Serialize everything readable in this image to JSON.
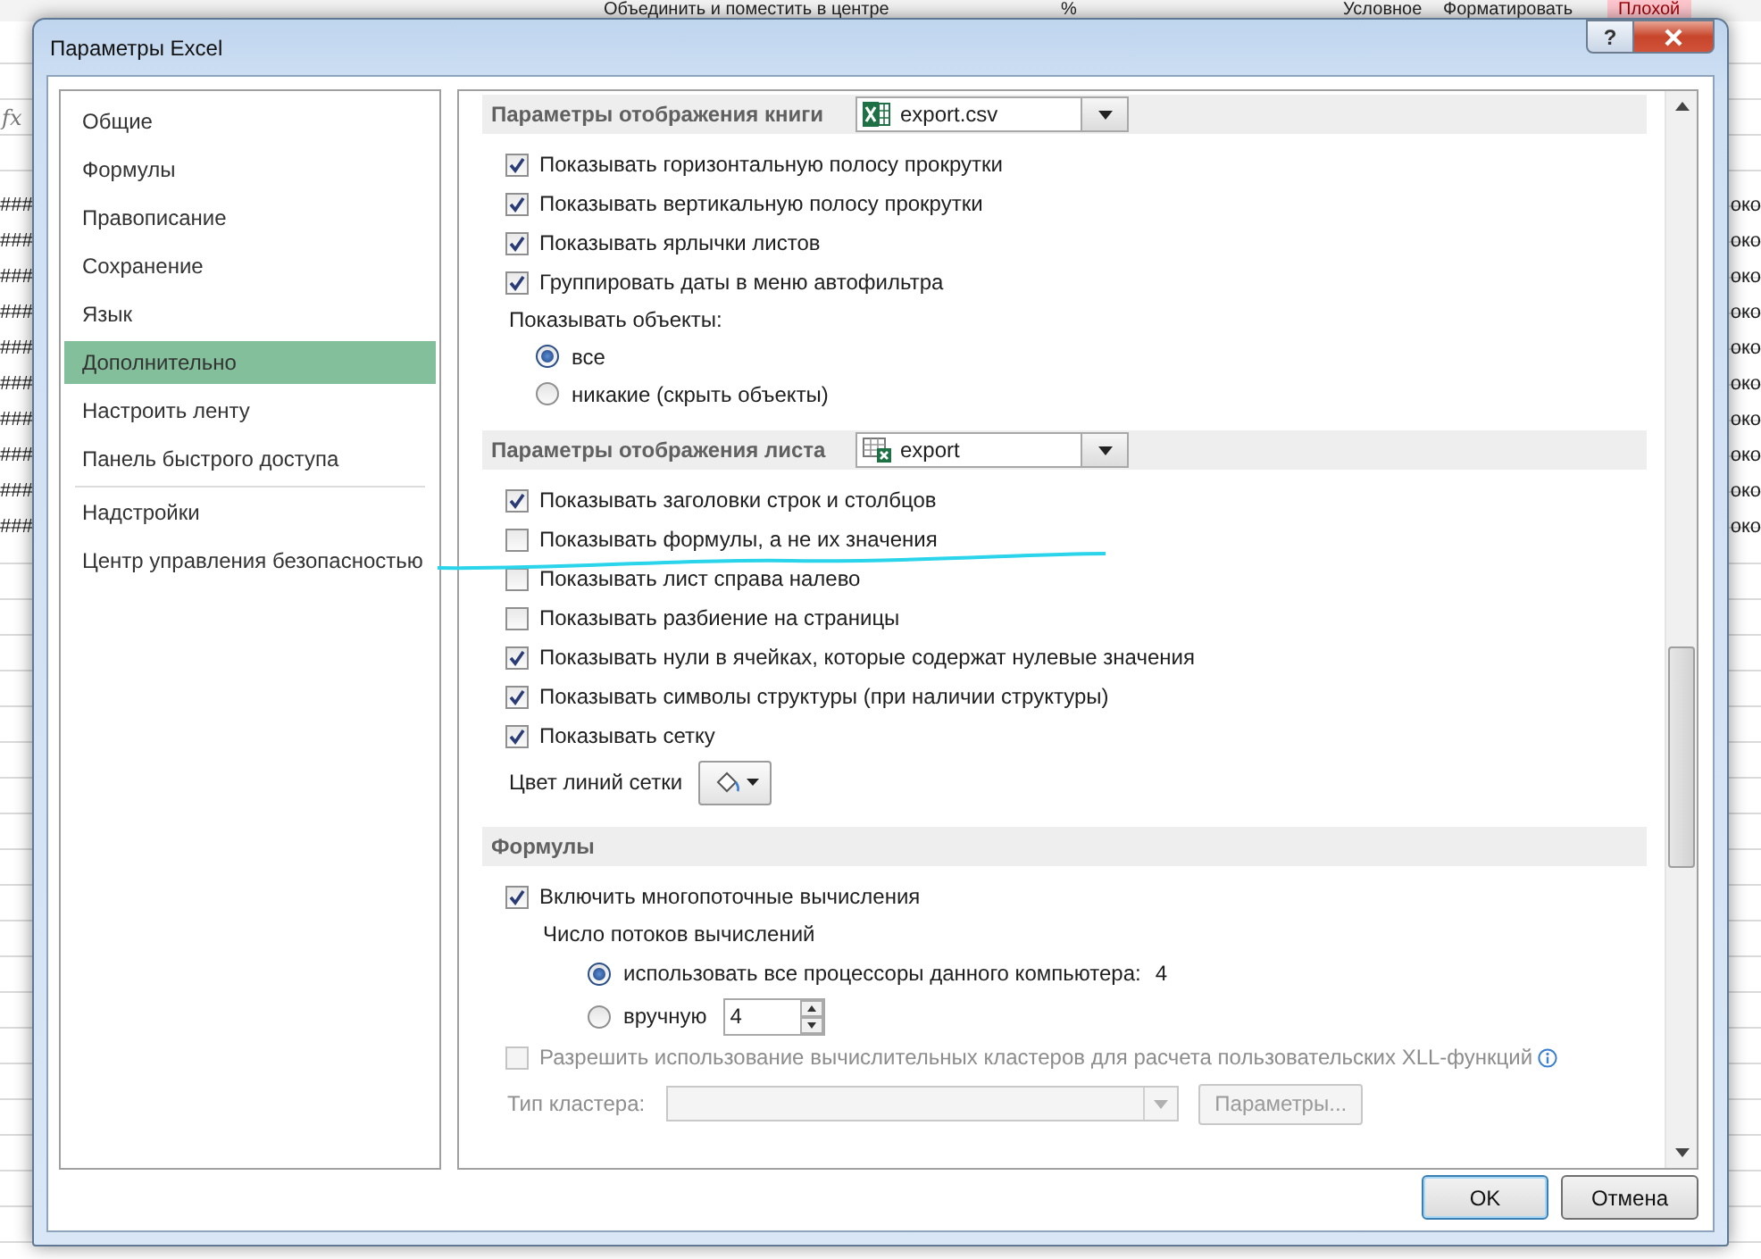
{
  "background": {
    "ribbon": [
      "Объединить и поместить в центре",
      "%",
      "Условное",
      "Форматировать"
    ],
    "style_cell": "Плохой",
    "formula_icon": "fx",
    "left_cells": [
      "###",
      "###",
      "###",
      "###",
      "###",
      "###",
      "###",
      "###",
      "###",
      "###"
    ],
    "right_cells": [
      "око",
      "око",
      "око",
      "око",
      "око",
      "око",
      "око",
      "око",
      "око",
      "око"
    ]
  },
  "window": {
    "title": "Параметры Excel",
    "help": "?"
  },
  "sidebar": {
    "items": [
      {
        "label": "Общие",
        "selected": false,
        "divider_before": false
      },
      {
        "label": "Формулы",
        "selected": false,
        "divider_before": false
      },
      {
        "label": "Правописание",
        "selected": false,
        "divider_before": false
      },
      {
        "label": "Сохранение",
        "selected": false,
        "divider_before": false
      },
      {
        "label": "Язык",
        "selected": false,
        "divider_before": false
      },
      {
        "label": "Дополнительно",
        "selected": true,
        "divider_before": false
      },
      {
        "label": "Настроить ленту",
        "selected": false,
        "divider_before": false
      },
      {
        "label": "Панель быстрого доступа",
        "selected": false,
        "divider_before": false
      },
      {
        "label": "Надстройки",
        "selected": false,
        "divider_before": true
      },
      {
        "label": "Центр управления безопасностью",
        "selected": false,
        "divider_before": false
      }
    ]
  },
  "sections": [
    {
      "title": "Параметры отображения книги",
      "selector": {
        "kind": "workbook",
        "value": "export.csv"
      },
      "items": [
        {
          "kind": "checkbox",
          "label": "Показывать горизонтальную полосу прокрутки",
          "checked": true
        },
        {
          "kind": "checkbox",
          "label": "Показывать вертикальную полосу прокрутки",
          "checked": true
        },
        {
          "kind": "checkbox",
          "label": "Показывать ярлычки листов",
          "checked": true
        },
        {
          "kind": "checkbox",
          "label": "Группировать даты в меню автофильтра",
          "checked": true
        },
        {
          "kind": "radio_group",
          "label": "Показывать объекты:",
          "options": [
            {
              "label": "все",
              "selected": true
            },
            {
              "label": "никакие (скрыть объекты)",
              "selected": false
            }
          ]
        }
      ]
    },
    {
      "title": "Параметры отображения листа",
      "selector": {
        "kind": "sheet",
        "value": "export"
      },
      "items": [
        {
          "kind": "checkbox",
          "label": "Показывать заголовки строк и столбцов",
          "checked": true
        },
        {
          "kind": "checkbox",
          "label": "Показывать формулы, а не их значения",
          "checked": false
        },
        {
          "kind": "checkbox",
          "label": "Показывать лист справа налево",
          "checked": false
        },
        {
          "kind": "checkbox",
          "label": "Показывать разбиение на страницы",
          "checked": false
        },
        {
          "kind": "checkbox",
          "label": "Показывать нули в ячейках, которые содержат нулевые значения",
          "checked": true
        },
        {
          "kind": "checkbox",
          "label": "Показывать символы структуры (при наличии структуры)",
          "checked": true
        },
        {
          "kind": "checkbox",
          "label": "Показывать сетку",
          "checked": true
        },
        {
          "kind": "color_picker",
          "label": "Цвет линий сетки"
        }
      ]
    },
    {
      "title": "Формулы",
      "items": [
        {
          "kind": "checkbox",
          "label": "Включить многопоточные вычисления",
          "checked": true,
          "disabled": false,
          "children": [
            {
              "kind": "radio_group",
              "label": "Число потоков вычислений",
              "options": [
                {
                  "label": "использовать все процессоры данного компьютера:",
                  "selected": true,
                  "value": "4"
                },
                {
                  "label": "вручную",
                  "selected": false,
                  "spin": "4"
                }
              ]
            }
          ]
        },
        {
          "kind": "checkbox",
          "label": "Разрешить использование вычислительных кластеров для расчета пользовательских XLL-функций",
          "checked": false,
          "disabled": true,
          "info": true
        },
        {
          "kind": "combo",
          "label": "Тип кластера:",
          "disabled": true,
          "button": "Параметры..."
        }
      ]
    }
  ],
  "buttons": [
    "OK",
    "Отмена"
  ]
}
